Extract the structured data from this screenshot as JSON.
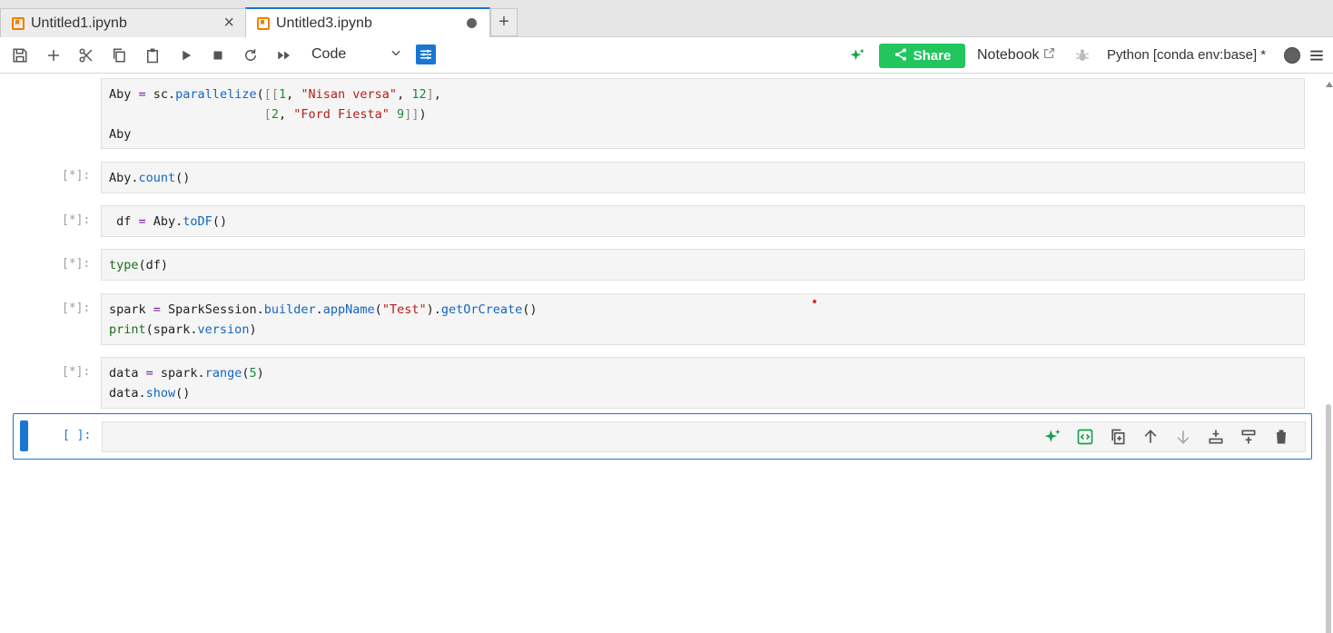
{
  "tabs": [
    {
      "label": "Untitled1.ipynb",
      "active": false
    },
    {
      "label": "Untitled3.ipynb",
      "active": true
    }
  ],
  "toolbar": {
    "cell_type": "Code",
    "share_label": "Share",
    "notebook_label": "Notebook",
    "kernel_label": "Python [conda env:base] *"
  },
  "cells": [
    {
      "prompt": "",
      "lines": [
        "Aby = sc.parallelize([[1, \"Nisan versa\", 12],",
        "                     [2, \"Ford Fiesta\" 9]])",
        "Aby"
      ]
    },
    {
      "prompt": "[*]:",
      "lines": [
        "Aby.count()"
      ]
    },
    {
      "prompt": "[*]:",
      "lines": [
        " df = Aby.toDF()"
      ]
    },
    {
      "prompt": "[*]:",
      "lines": [
        "type(df)"
      ]
    },
    {
      "prompt": "[*]:",
      "lines": [
        "spark = SparkSession.builder.appName(\"Test\").getOrCreate()",
        "print(spark.version)"
      ]
    },
    {
      "prompt": "[*]:",
      "lines": [
        "data = spark.range(5)",
        "data.show()"
      ]
    }
  ],
  "active_cell": {
    "prompt": "[ ]:"
  },
  "colors": {
    "accent": "#1976d2",
    "share": "#22c55e",
    "notebook_icon": "#f57c00"
  }
}
